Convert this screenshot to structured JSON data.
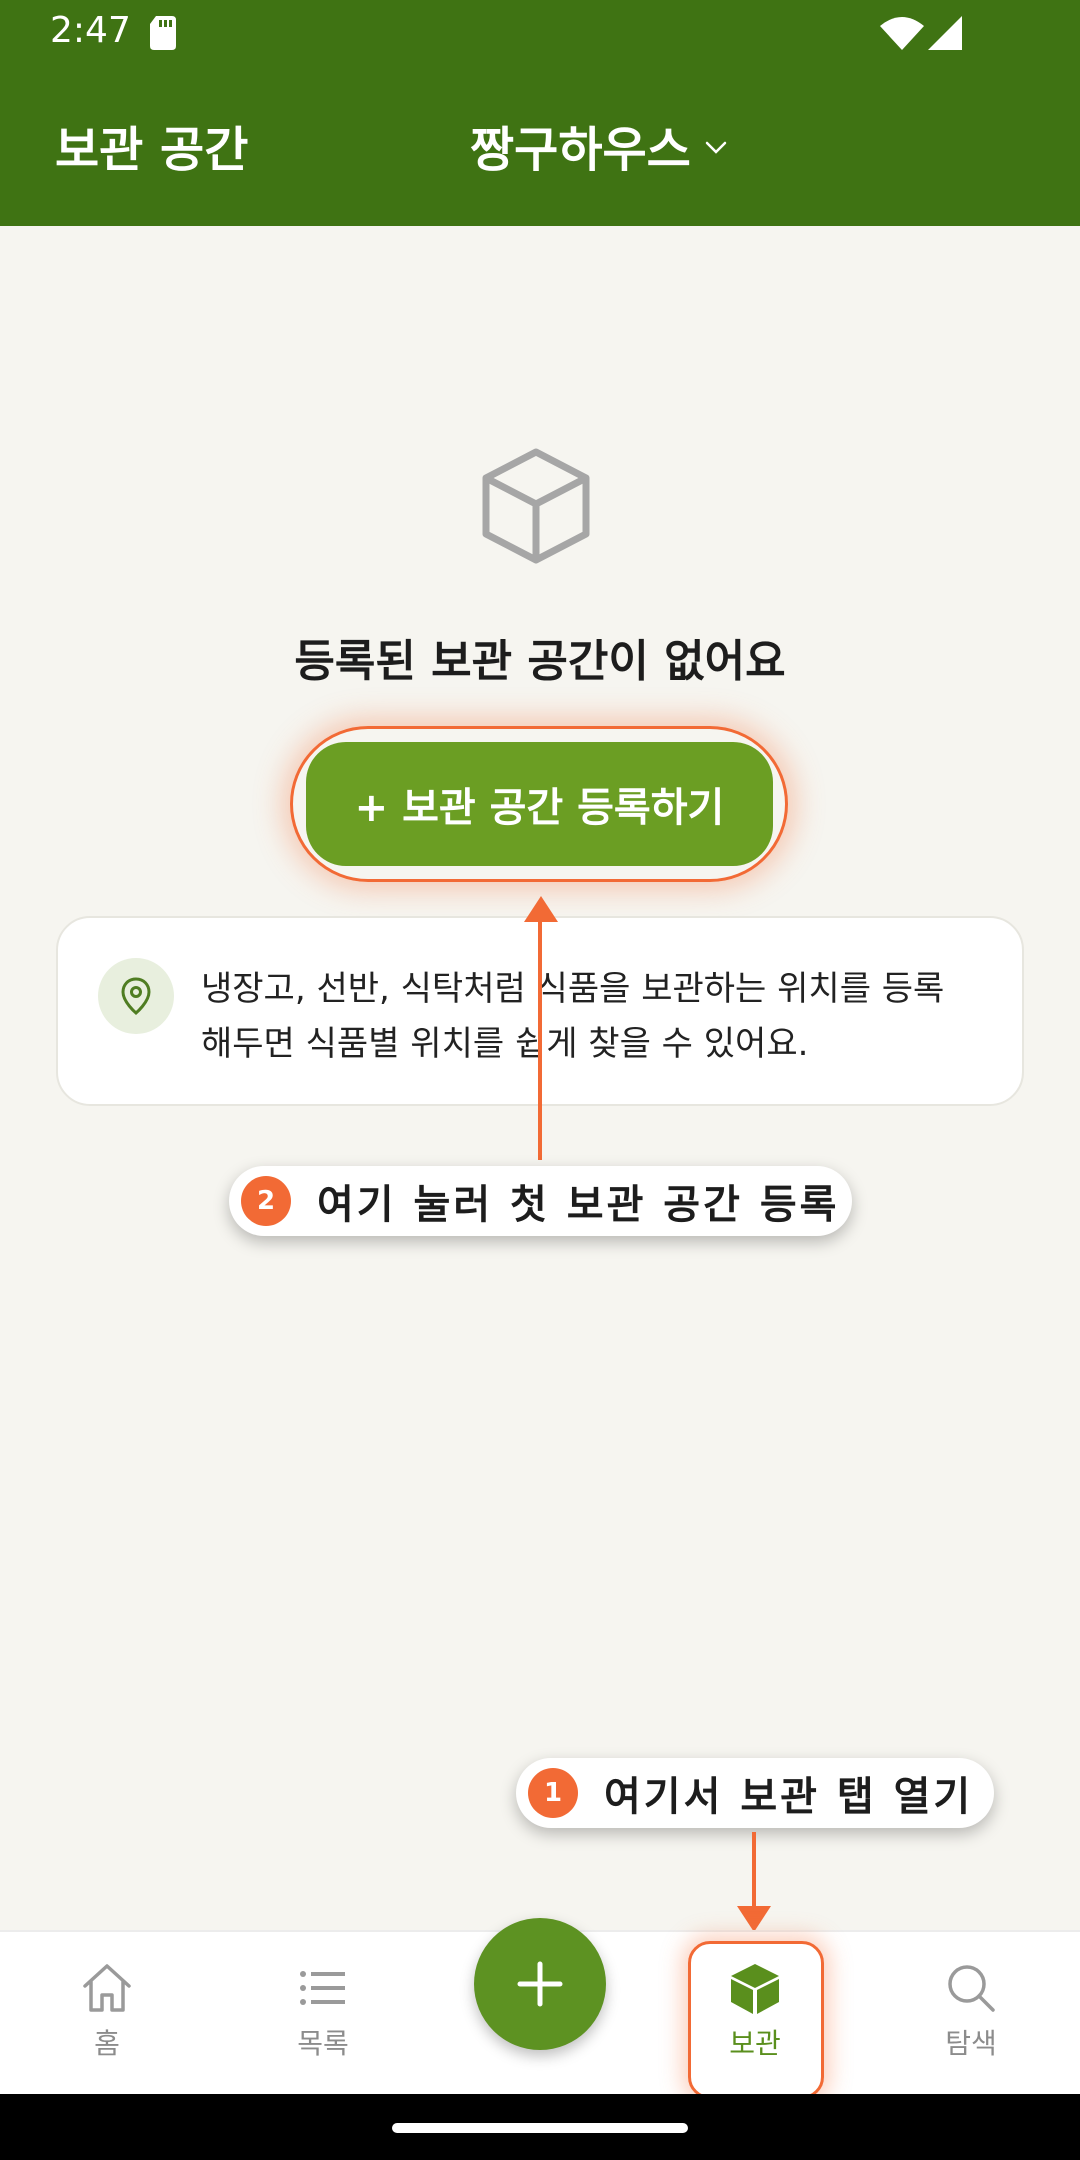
{
  "status_bar": {
    "time": "2:47",
    "icons": [
      "sd-card-icon",
      "wifi-icon",
      "signal-icon"
    ]
  },
  "header": {
    "title": "보관 공간",
    "house_name": "짱구하우스",
    "dropdown_icon": "chevron-down-icon"
  },
  "empty_state": {
    "icon": "box-icon",
    "title": "등록된 보관 공간이 없어요",
    "add_button_label": "+ 보관 공간 등록하기"
  },
  "info_card": {
    "icon": "location-pin-icon",
    "text_line1": "냉장고, 선반, 식탁처럼 식품을 보관하는 위치를 등록",
    "text_line2": "해두면 식품별 위치를 쉽게 찾을 수 있어요."
  },
  "callouts": {
    "step2": {
      "number": "2",
      "text": "여기 눌러 첫 보관 공간 등록"
    },
    "step1": {
      "number": "1",
      "text": "여기서 보관 탭 열기"
    }
  },
  "bottom_nav": {
    "items": [
      {
        "label": "홈",
        "icon": "home-icon",
        "active": false
      },
      {
        "label": "목록",
        "icon": "list-icon",
        "active": false
      },
      {
        "label": "보관",
        "icon": "cube-icon",
        "active": true
      },
      {
        "label": "탐색",
        "icon": "search-icon",
        "active": false
      }
    ],
    "fab_icon": "plus-icon"
  },
  "colors": {
    "brand_dark": "#3f7313",
    "brand": "#6b9e23",
    "accent": "#f26a35",
    "background": "#f6f5f0"
  }
}
